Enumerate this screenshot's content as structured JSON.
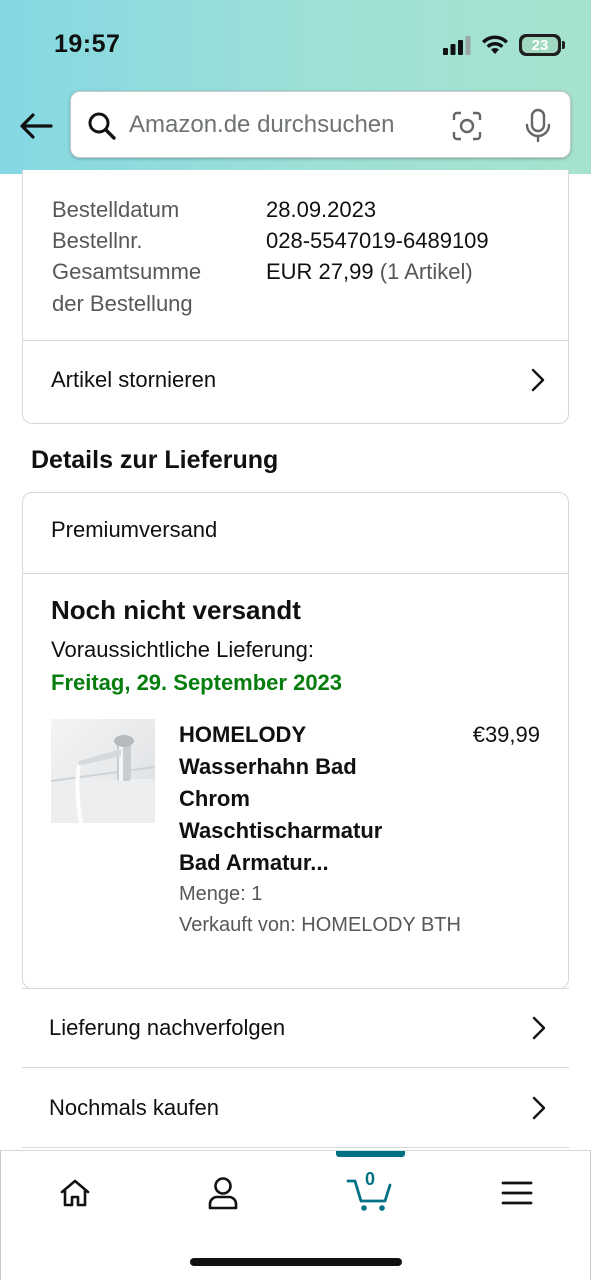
{
  "status_bar": {
    "time": "19:57",
    "battery": "23"
  },
  "search": {
    "placeholder": "Amazon.de durchsuchen"
  },
  "order": {
    "date_label": "Bestelldatum",
    "date_value": "28.09.2023",
    "number_label": "Bestellnr.",
    "number_value": "028-5547019-6489109",
    "total_label_line1": "Gesamtsumme",
    "total_label_line2": "der Bestellung",
    "total_value": "EUR 27,99",
    "total_count": "(1 Artikel)",
    "cancel_link": "Artikel stornieren"
  },
  "delivery": {
    "section_title": "Details zur Lieferung",
    "shipping_method": "Premiumversand",
    "status": "Noch nicht versandt",
    "eta_label": "Voraussichtliche Lieferung:",
    "eta_date": "Freitag, 29. September 2023",
    "item": {
      "title_lines": [
        "HOMELODY",
        "Wasserhahn Bad",
        "Chrom",
        "Waschtischarmatur",
        "Bad Armatur..."
      ],
      "price": "€39,99",
      "quantity": "Menge: 1",
      "seller": "Verkauft von: HOMELODY BTH"
    }
  },
  "actions": {
    "track": "Lieferung nachverfolgen",
    "buy_again": "Nochmals kaufen"
  },
  "bottom_nav": {
    "cart_count": "0",
    "active_color": "#007185",
    "items": [
      "home-icon",
      "account-icon",
      "cart-icon",
      "menu-icon"
    ]
  },
  "colors": {
    "delivery_green": "#067d0d",
    "accent_teal": "#007185"
  }
}
